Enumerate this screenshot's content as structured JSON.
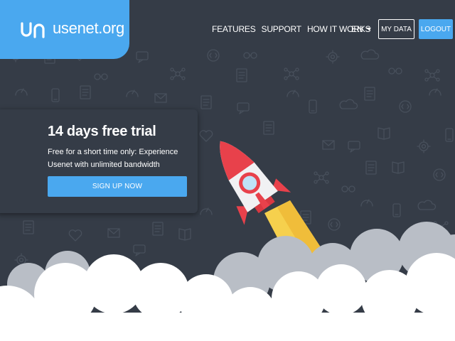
{
  "brand": {
    "name": "usenet",
    "tld": ".org",
    "accent_color": "#4aa8ef",
    "background_color": "#353c47",
    "rocket_color": "#e8414b"
  },
  "nav": {
    "items": [
      {
        "label": "FEATURES"
      },
      {
        "label": "SUPPORT"
      },
      {
        "label": "HOW IT WORKS"
      }
    ],
    "language": "EN",
    "my_data_label": "MY DATA",
    "logout_label": "LOGOUT"
  },
  "trial": {
    "title": "14 days free trial",
    "description": "Free for a short time only: Experience Usenet with unlimited bandwidth",
    "cta_label": "SIGN UP NOW"
  },
  "icons": {
    "logo": "un-logo-icon",
    "language_caret": "chevron-down-icon",
    "hero": "rocket-icon"
  }
}
